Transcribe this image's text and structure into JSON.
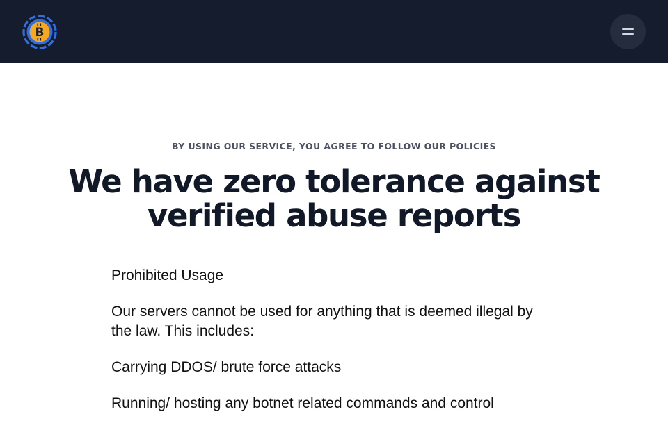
{
  "header": {
    "logo_icon": "bitcoin-logo-icon",
    "menu_icon": "hamburger-menu-icon",
    "colors": {
      "background": "#151c2e",
      "logo_orange": "#f7a823",
      "logo_blue": "#2f6fe0"
    }
  },
  "main": {
    "eyebrow": "BY USING OUR SERVICE, YOU AGREE TO FOLLOW OUR POLICIES",
    "title": "We have zero tolerance against verified abuse reports",
    "paragraphs": [
      "Prohibited Usage",
      "Our servers cannot be used for anything that is deemed illegal by the law. This includes:",
      "Carrying DDOS/ brute force attacks",
      "Running/ hosting any botnet related commands and control"
    ]
  }
}
